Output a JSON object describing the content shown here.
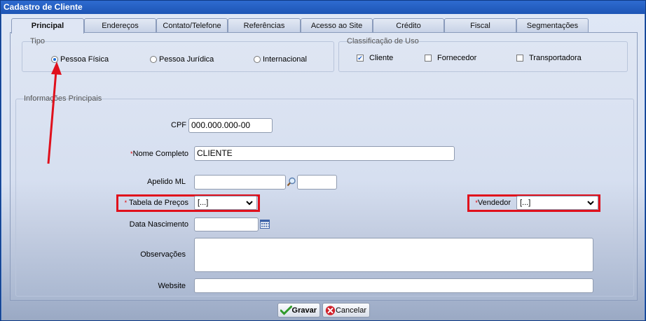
{
  "window": {
    "title": "Cadastro de Cliente"
  },
  "tabs": [
    {
      "label": "Principal",
      "active": true
    },
    {
      "label": "Endereços"
    },
    {
      "label": "Contato/Telefone"
    },
    {
      "label": "Referências"
    },
    {
      "label": "Acesso ao Site"
    },
    {
      "label": "Crédito"
    },
    {
      "label": "Fiscal"
    },
    {
      "label": "Segmentações"
    }
  ],
  "tipo": {
    "legend": "Tipo",
    "options": [
      {
        "label": "Pessoa Física",
        "selected": true
      },
      {
        "label": "Pessoa Jurídica",
        "selected": false
      },
      {
        "label": "Internacional",
        "selected": false
      }
    ]
  },
  "classificacao": {
    "legend": "Classificação de Uso",
    "options": [
      {
        "label": "Cliente",
        "checked": true
      },
      {
        "label": "Fornecedor",
        "checked": false
      },
      {
        "label": "Transportadora",
        "checked": false
      }
    ]
  },
  "info": {
    "legend": "Informações Principais",
    "cpf": {
      "label": "CPF",
      "value": "000.000.000-00"
    },
    "nome": {
      "label": "Nome Completo",
      "value": "CLIENTE"
    },
    "apelido": {
      "label": "Apelido ML",
      "value": "",
      "extra_value": ""
    },
    "tabela_precos": {
      "label": "Tabela de Preços",
      "value": "[...]"
    },
    "vendedor": {
      "label": "Vendedor",
      "value": "[...]"
    },
    "data_nascimento": {
      "label": "Data Nascimento",
      "value": ""
    },
    "observacoes": {
      "label": "Observações",
      "value": ""
    },
    "website": {
      "label": "Website",
      "value": ""
    }
  },
  "required_mark": "*",
  "buttons": {
    "save": "Gravar",
    "cancel": "Cancelar"
  },
  "icons": {
    "search": "magnifier-icon",
    "calendar": "calendar-icon",
    "save": "check-icon",
    "cancel": "cancel-icon"
  },
  "colors": {
    "titlebar": "#1d55b5",
    "annotation": "#e0101c",
    "required": "#d00000"
  }
}
